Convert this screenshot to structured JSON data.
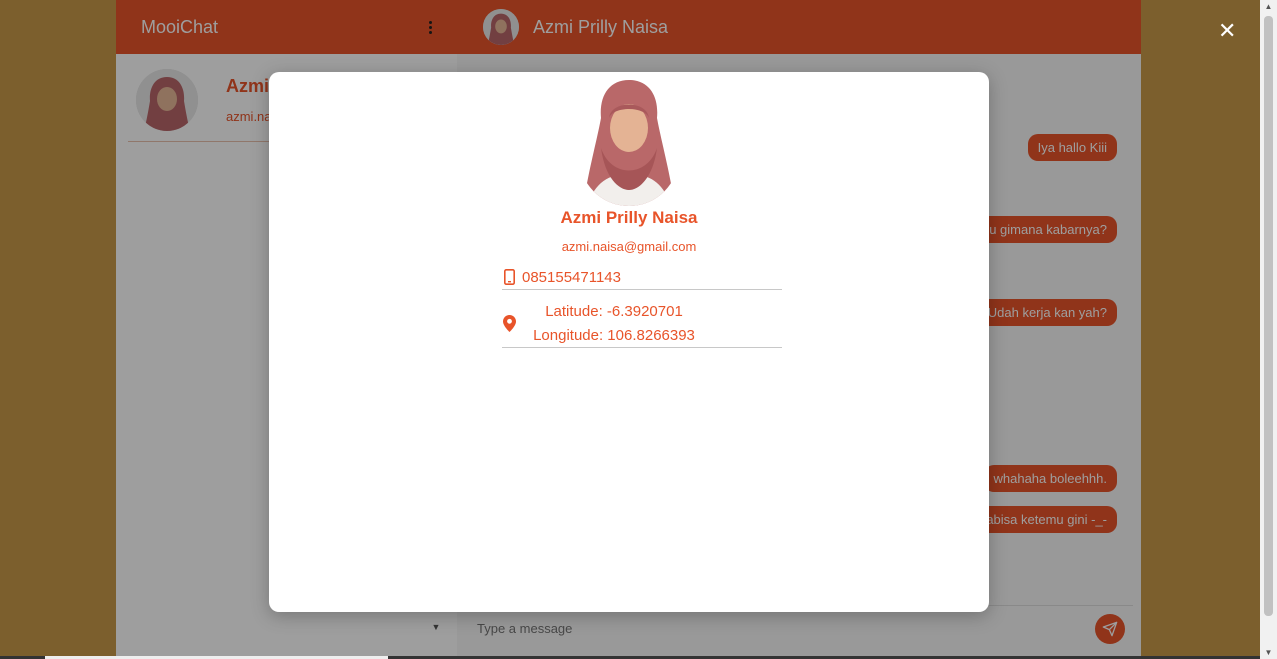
{
  "app": {
    "brand": "MooiChat"
  },
  "contact_list": [
    {
      "name": "Azmi",
      "email": "azmi.na"
    }
  ],
  "chat": {
    "header_name": "Azmi Prilly Naisa",
    "messages": [
      "Iya hallo Kiii",
      "nu gimana kabarnya?",
      "' Udah kerja kan yah?",
      "whahaha boleehhh.",
      "abisa ketemu gini -_-"
    ],
    "composer_placeholder": "Type a message"
  },
  "profile_modal": {
    "name": "Azmi Prilly Naisa",
    "email": "azmi.naisa@gmail.com",
    "phone": "085155471143",
    "latitude": "Latitude: -6.3920701",
    "longitude": "Longitude: 106.8266393"
  },
  "colors": {
    "accent": "#e8542a",
    "backdrop": "#c99a4a"
  },
  "icons": {
    "menu": "kebab-menu-icon",
    "phone": "phone-icon",
    "location": "map-pin-icon",
    "send": "send-icon",
    "close": "close-icon"
  }
}
